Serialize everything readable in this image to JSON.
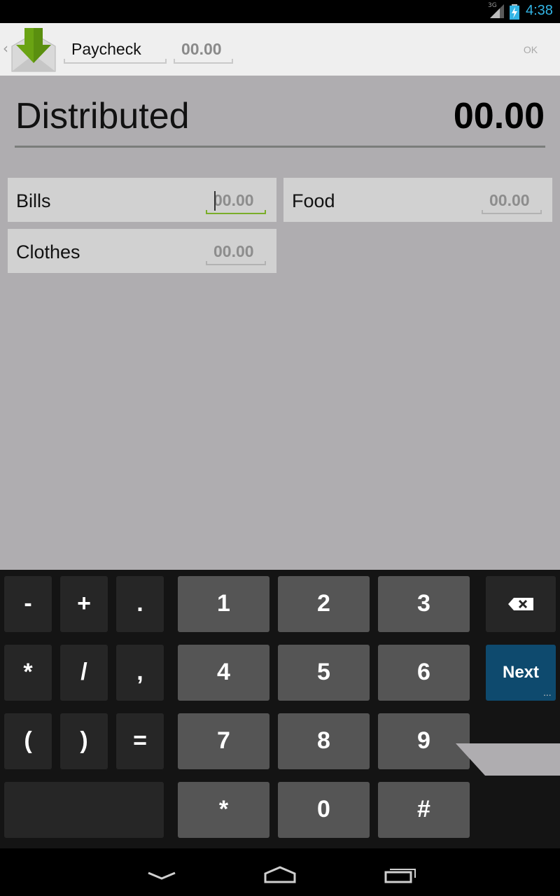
{
  "status_bar": {
    "network": "3G",
    "time": "4:38",
    "icons": [
      "signal-icon",
      "battery-charging-icon"
    ]
  },
  "action_bar": {
    "back_icon": "chevron-left-icon",
    "app_icon": "envelope-download-icon",
    "name_value": "Paycheck",
    "amount_value": "00.00",
    "ok_label": "OK"
  },
  "distributed": {
    "label": "Distributed",
    "total": "00.00"
  },
  "categories": [
    {
      "label": "Bills",
      "amount": "00.00",
      "focused": true
    },
    {
      "label": "Food",
      "amount": "00.00",
      "focused": false
    },
    {
      "label": "Clothes",
      "amount": "00.00",
      "focused": false
    }
  ],
  "keyboard": {
    "symbols": [
      "-",
      "+",
      ".",
      "*",
      "/",
      ",",
      "(",
      ")",
      "="
    ],
    "digits": [
      "1",
      "2",
      "3",
      "4",
      "5",
      "6",
      "7",
      "8",
      "9",
      "*",
      "0",
      "#"
    ],
    "next_label": "Next",
    "next_dots": "...",
    "delete_icon": "backspace-icon",
    "colors": {
      "symbol_key": "#262626",
      "digit_key": "#555555",
      "next_key": "#0e4a6e"
    }
  },
  "nav_bar": {
    "icons": [
      "back-icon",
      "home-icon",
      "recents-icon"
    ]
  },
  "colors": {
    "accent": "#33b5e5",
    "focus_underline": "#7aad2a",
    "app_green": "#6aa313"
  }
}
